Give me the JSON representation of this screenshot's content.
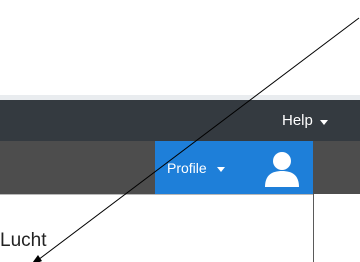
{
  "header": {
    "help_label": "Help",
    "profile_label": "Profile"
  },
  "content": {
    "text": "Lucht"
  },
  "icons": {
    "avatar": "user-avatar-icon",
    "help_caret": "caret-down-icon",
    "profile_caret": "caret-down-icon",
    "pointer": "arrow-annotation"
  },
  "colors": {
    "topbar": "#343a40",
    "subbar": "#4d4d4d",
    "profile_button": "#1e7fd9",
    "text_light": "#ffffff"
  }
}
